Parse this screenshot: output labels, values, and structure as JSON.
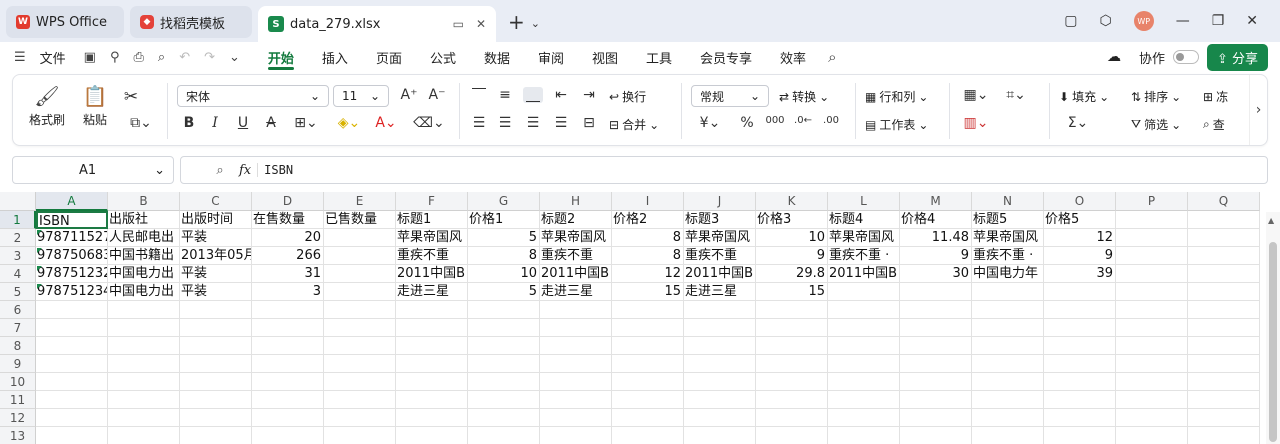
{
  "tabs": [
    {
      "label": "WPS Office",
      "icon": "wps-logo-icon"
    },
    {
      "label": "找稻壳模板",
      "icon": "docer-logo-icon"
    },
    {
      "label": "data_279.xlsx",
      "icon": "spreadsheet-logo-icon"
    }
  ],
  "user": {
    "avatar": "WP"
  },
  "menu": {
    "file": "文件",
    "items": [
      "开始",
      "插入",
      "页面",
      "公式",
      "数据",
      "审阅",
      "视图",
      "工具",
      "会员专享",
      "效率"
    ],
    "active": "开始",
    "collab": "协作",
    "share": "分享"
  },
  "ribbon": {
    "format_painter": "格式刷",
    "paste": "粘贴",
    "font": "宋体",
    "font_size": "11",
    "wrap": "换行",
    "merge": "合并",
    "number_format": "常规",
    "convert": "转换",
    "rows_cols": "行和列",
    "worksheet": "工作表",
    "fill": "填充",
    "sort": "排序",
    "filter": "筛选",
    "clear_partial": "冻",
    "find_partial": "查"
  },
  "formula": {
    "cell_ref": "A1",
    "value": "ISBN"
  },
  "columns": [
    "A",
    "B",
    "C",
    "D",
    "E",
    "F",
    "G",
    "H",
    "I",
    "J",
    "K",
    "L",
    "M",
    "N",
    "O",
    "P",
    "Q"
  ],
  "rows": [
    [
      "ISBN",
      "出版社",
      "出版时间",
      "在售数量",
      "已售数量",
      "标题1",
      "价格1",
      "标题2",
      "价格2",
      "标题3",
      "价格3",
      "标题4",
      "价格4",
      "标题5",
      "价格5",
      "",
      ""
    ],
    [
      "978711527",
      "人民邮电出",
      "平装",
      "20",
      "",
      "苹果帝国风",
      "5",
      "苹果帝国风",
      "8",
      "苹果帝国风",
      "10",
      "苹果帝国风",
      "11.48",
      "苹果帝国风",
      "12",
      "",
      ""
    ],
    [
      "978750683",
      "中国书籍出",
      "2013年05月",
      "266",
      "",
      "重疾不重",
      "8",
      "重疾不重",
      "8",
      "重疾不重",
      "9",
      "重疾不重 ·",
      "9",
      "重疾不重 ·",
      "9",
      "",
      ""
    ],
    [
      "978751232",
      "中国电力出",
      "平装",
      "31",
      "",
      "2011中国B",
      "10",
      "2011中国B",
      "12",
      "2011中国B",
      "29.8",
      "2011中国B",
      "30",
      "中国电力年",
      "39",
      "",
      ""
    ],
    [
      "978751234",
      "中国电力出",
      "平装",
      "3",
      "",
      "走进三星",
      "5",
      "走进三星",
      "15",
      "走进三星",
      "15",
      "",
      "",
      "",
      "",
      "",
      ""
    ],
    [
      "",
      "",
      "",
      "",
      "",
      "",
      "",
      "",
      "",
      "",
      "",
      "",
      "",
      "",
      "",
      "",
      ""
    ],
    [
      "",
      "",
      "",
      "",
      "",
      "",
      "",
      "",
      "",
      "",
      "",
      "",
      "",
      "",
      "",
      "",
      ""
    ],
    [
      "",
      "",
      "",
      "",
      "",
      "",
      "",
      "",
      "",
      "",
      "",
      "",
      "",
      "",
      "",
      "",
      ""
    ],
    [
      "",
      "",
      "",
      "",
      "",
      "",
      "",
      "",
      "",
      "",
      "",
      "",
      "",
      "",
      "",
      "",
      ""
    ],
    [
      "",
      "",
      "",
      "",
      "",
      "",
      "",
      "",
      "",
      "",
      "",
      "",
      "",
      "",
      "",
      "",
      ""
    ],
    [
      "",
      "",
      "",
      "",
      "",
      "",
      "",
      "",
      "",
      "",
      "",
      "",
      "",
      "",
      "",
      "",
      ""
    ],
    [
      "",
      "",
      "",
      "",
      "",
      "",
      "",
      "",
      "",
      "",
      "",
      "",
      "",
      "",
      "",
      "",
      ""
    ],
    [
      "",
      "",
      "",
      "",
      "",
      "",
      "",
      "",
      "",
      "",
      "",
      "",
      "",
      "",
      "",
      "",
      ""
    ]
  ],
  "row_numbers": [
    "1",
    "2",
    "3",
    "4",
    "5",
    "6",
    "7",
    "8",
    "9",
    "10",
    "11",
    "12",
    "13"
  ]
}
